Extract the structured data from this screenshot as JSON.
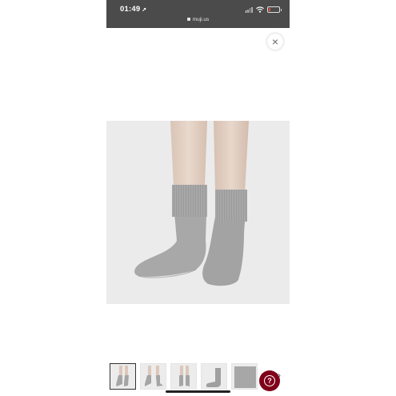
{
  "status_bar": {
    "time": "01:49",
    "location_glyph": "➚",
    "url": "muji.us",
    "battery_color": "#e94b3c",
    "background": "#4b4b4b"
  },
  "viewer": {
    "close_glyph": "×",
    "main_image": "gray-ribbed-crew-socks-on-legs",
    "thumbnails": [
      {
        "name": "socks-front-view",
        "selected": true
      },
      {
        "name": "socks-angle-view",
        "selected": false
      },
      {
        "name": "socks-back-view",
        "selected": false
      },
      {
        "name": "single-sock-side-view",
        "selected": false
      },
      {
        "name": "sock-fabric-closeup",
        "selected": false
      }
    ],
    "next_glyph": "›",
    "help_glyph": "?",
    "help_color": "#7f0019"
  }
}
